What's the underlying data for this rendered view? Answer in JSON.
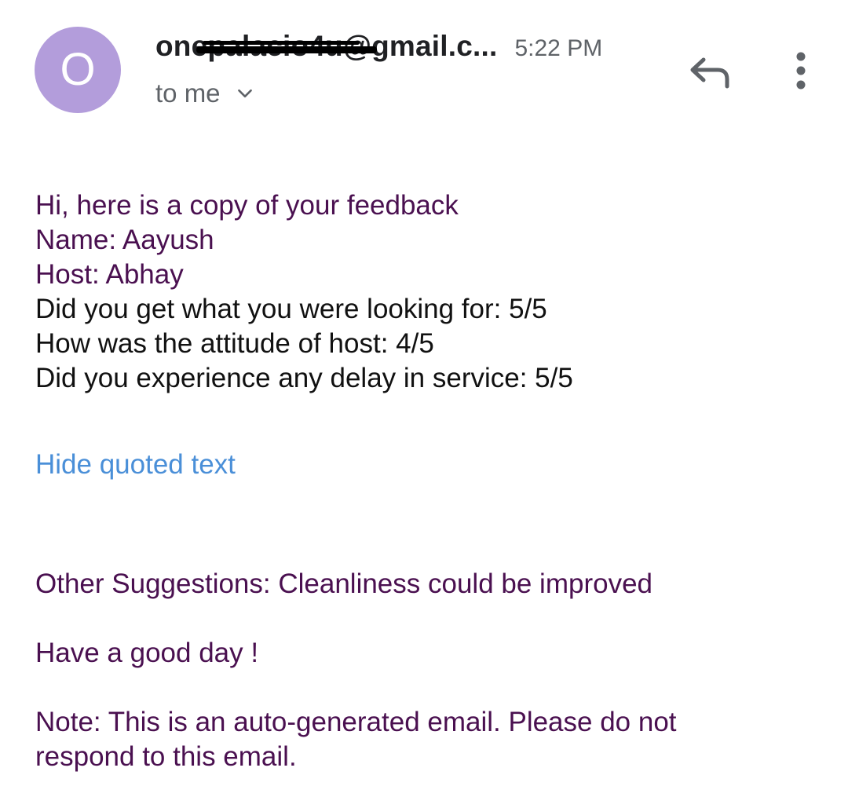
{
  "header": {
    "avatar_letter": "O",
    "sender": "onepalacio4u@gmail.c...",
    "time": "5:22 PM",
    "recipient": "to me"
  },
  "icons": {
    "reply": "reply-icon",
    "more": "more-vert-icon",
    "expand": "chevron-down-icon"
  },
  "body": {
    "greeting": "Hi, here is a copy of your feedback",
    "name_line": "Name: Aayush",
    "host_line": "Host: Abhay",
    "q1": "Did you get what you were looking for: 5/5",
    "q2": "How was the attitude of host: 4/5",
    "q3": "Did you experience any delay in service: 5/5",
    "hide_quoted": "Hide quoted text",
    "suggestions": "Other Suggestions: Cleanliness could be improved",
    "sign_off": "Have a good day !",
    "note_line1": "Note: This is an auto-generated email. Please do not",
    "note_line2": "respond to this email."
  },
  "colors": {
    "avatar_bg": "#b39ddb",
    "body_purple": "#4a1050",
    "link_blue": "#4a8fd8",
    "secondary_gray": "#5f6368"
  }
}
